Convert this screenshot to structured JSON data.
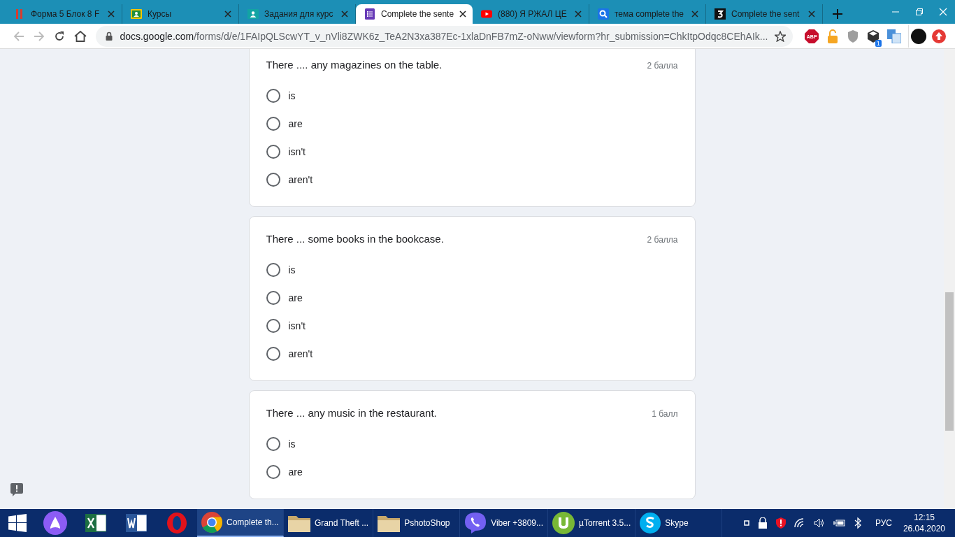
{
  "tabs": [
    {
      "title": "Форма 5 Блок 8 F",
      "selected": false
    },
    {
      "title": "Курсы",
      "selected": false
    },
    {
      "title": "Задания для курс",
      "selected": false
    },
    {
      "title": "Complete the sente",
      "selected": true
    },
    {
      "title": "(880) Я РЖАЛ ЦЕ",
      "selected": false
    },
    {
      "title": "тема complete the",
      "selected": false
    },
    {
      "title": "Complete the sent",
      "selected": false
    }
  ],
  "address": {
    "host": "docs.google.com",
    "path": "/forms/d/e/1FAIpQLScwYT_v_nVli8ZWK6z_TeA2N3xa387Ec-1xlaDnFB7mZ-oNww/viewform?hr_submission=ChkItpOdqc8CEhAIk..."
  },
  "extensions": {
    "adblock_label": "ABP",
    "badge": "1"
  },
  "questions": [
    {
      "title": "There .... any magazines on the table.",
      "points": "2 балла",
      "options": [
        {
          "label": "is",
          "selected": false
        },
        {
          "label": "are",
          "selected": false
        },
        {
          "label": "isn't",
          "selected": false
        },
        {
          "label": "aren't",
          "selected": false
        }
      ]
    },
    {
      "title": "There ... some books in the bookcase.",
      "points": "2 балла",
      "options": [
        {
          "label": "is",
          "selected": false
        },
        {
          "label": "are",
          "selected": false
        },
        {
          "label": "isn't",
          "selected": false
        },
        {
          "label": "aren't",
          "selected": false
        }
      ]
    },
    {
      "title": "There ... any music in the restaurant.",
      "points": "1 балл",
      "options": [
        {
          "label": "is",
          "selected": false
        },
        {
          "label": "are",
          "selected": false
        }
      ]
    }
  ],
  "taskbar": {
    "apps": [
      {
        "label": "Complete th...",
        "selected": true
      },
      {
        "label": "Grand Theft ...",
        "selected": false
      },
      {
        "label": "PshotoShop",
        "selected": false
      },
      {
        "label": "Viber +3809...",
        "selected": false
      },
      {
        "label": "µTorrent 3.5...",
        "selected": false
      },
      {
        "label": "Skype",
        "selected": false
      }
    ],
    "language": "РУС",
    "time": "12:15",
    "date": "26.04.2020"
  }
}
